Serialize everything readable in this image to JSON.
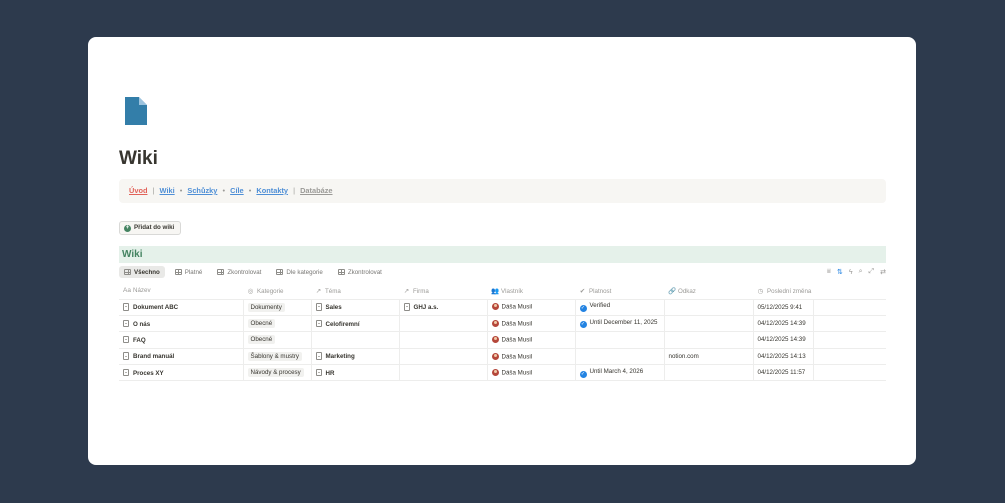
{
  "page": {
    "icon": "page-document-icon",
    "title": "Wiki"
  },
  "colors": {
    "background": "#2d3a4d",
    "accent_green": "#448361",
    "link_blue": "#4f8fd6",
    "link_red": "#e16259",
    "verified_blue": "#2383e2"
  },
  "nav": {
    "uvod": "Úvod",
    "sep1": "|",
    "wiki": "Wiki",
    "dot1": "•",
    "schuzky": "Schůzky",
    "dot2": "•",
    "cile": "Cíle",
    "dot3": "•",
    "kontakty": "Kontakty",
    "sep2": "|",
    "databaze": "Databáze"
  },
  "add_button": {
    "icon": "plus-circle-icon",
    "label": "Přidat do wiki"
  },
  "database": {
    "title": "Wiki",
    "views": [
      {
        "label": "Všechno",
        "active": true
      },
      {
        "label": "Platné"
      },
      {
        "label": "Zkontrolovat"
      },
      {
        "label": "Dle kategorie"
      },
      {
        "label": "Zkontrolovat"
      }
    ],
    "tools": [
      "filter-icon",
      "sort-icon",
      "lightning-icon",
      "search-icon",
      "expand-icon",
      "settings-icon"
    ],
    "columns": [
      {
        "label": "Název",
        "icon": "Aa"
      },
      {
        "label": "Kategorie",
        "icon": "◎"
      },
      {
        "label": "Téma",
        "icon": "↗"
      },
      {
        "label": "Firma",
        "icon": "↗"
      },
      {
        "label": "Vlastník",
        "icon": "👥"
      },
      {
        "label": "Platnost",
        "icon": "✔"
      },
      {
        "label": "Odkaz",
        "icon": "🔗"
      },
      {
        "label": "Poslední změna",
        "icon": "◷"
      }
    ],
    "rows": [
      {
        "name": "Dokument ABC",
        "category": "Dokumenty",
        "topic": "Sales",
        "company": "GHJ a.s.",
        "owner": "Dáša Musil",
        "validity": "Verified",
        "link": "",
        "modified": "05/12/2025 9:41"
      },
      {
        "name": "O nás",
        "category": "Obecné",
        "topic": "Celofiremní",
        "company": "",
        "owner": "Dáša Musil",
        "validity": "Until December 11, 2025",
        "link": "",
        "modified": "04/12/2025 14:39"
      },
      {
        "name": "FAQ",
        "category": "Obecné",
        "topic": "",
        "company": "",
        "owner": "Dáša Musil",
        "validity": "",
        "link": "",
        "modified": "04/12/2025 14:39"
      },
      {
        "name": "Brand manuál",
        "category": "Šablony & mustry",
        "topic": "Marketing",
        "company": "",
        "owner": "Dáša Musil",
        "validity": "",
        "link": "notion.com",
        "modified": "04/12/2025 14:13"
      },
      {
        "name": "Proces XY",
        "category": "Návody & procesy",
        "topic": "HR",
        "company": "",
        "owner": "Dáša Musil",
        "validity": "Until March 4, 2026",
        "link": "",
        "modified": "04/12/2025 11:57"
      }
    ]
  }
}
